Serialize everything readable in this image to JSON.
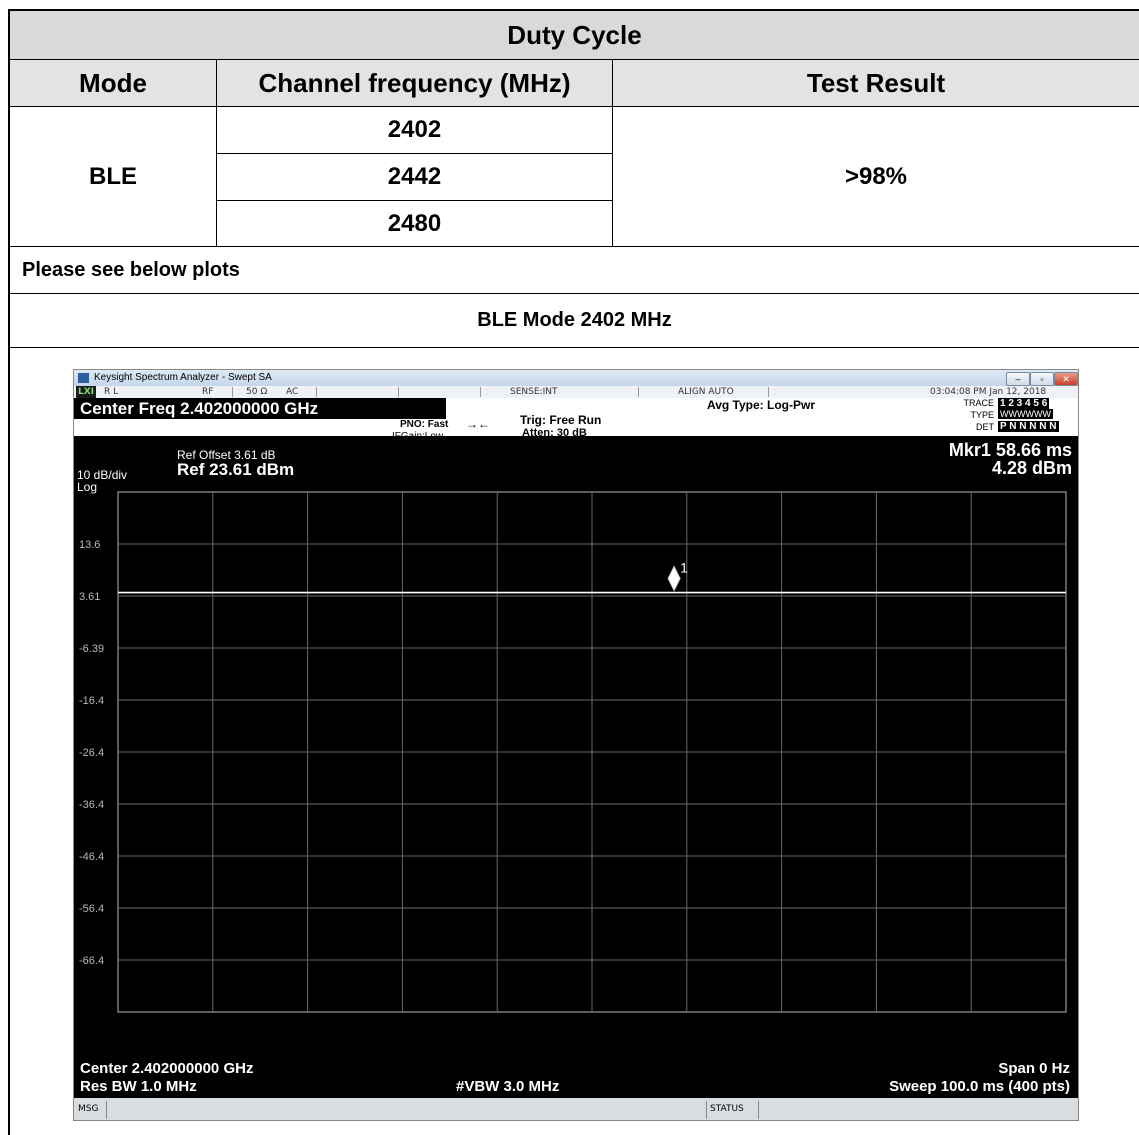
{
  "table": {
    "title": "Duty Cycle",
    "headers": [
      "Mode",
      "Channel frequency (MHz)",
      "Test Result"
    ],
    "mode": "BLE",
    "channels": [
      "2402",
      "2442",
      "2480"
    ],
    "result": ">98%",
    "note": "Please see below plots",
    "plot_caption": "BLE Mode 2402 MHz"
  },
  "analyzer": {
    "window_title": "Keysight Spectrum Analyzer - Swept SA",
    "window_buttons": [
      "–",
      "▫",
      "✕"
    ],
    "status_row": {
      "lxi": "LXI",
      "rl": "R L",
      "rf": "RF",
      "impedance": "50 Ω",
      "coupling": "AC",
      "sense": "SENSE:INT",
      "align": "ALIGN AUTO",
      "timestamp": "03:04:08 PM Jan 12, 2018"
    },
    "center_freq_title": "Center Freq 2.402000000 GHz",
    "pno": "PNO: Fast",
    "ifgain": "IFGain:Low",
    "trig": "Trig: Free Run",
    "atten": "Atten: 30 dB",
    "avg_type": "Avg Type: Log-Pwr",
    "trace_panel": {
      "trace_label": "TRACE",
      "trace_values": "1 2 3 4 5 6",
      "type_label": "TYPE",
      "type_values": "WWWWWW",
      "det_label": "DET",
      "det_values": "P N N N N N"
    },
    "ref_offset": "Ref Offset 3.61 dB",
    "ref_level": "Ref 23.61 dBm",
    "scale": "10 dB/div",
    "scale_type": "Log",
    "marker_readout_1": "Mkr1 58.66 ms",
    "marker_readout_2": "4.28 dBm",
    "marker_label": "1",
    "bottom": {
      "center": "Center 2.402000000 GHz",
      "span": "Span 0 Hz",
      "res_bw": "Res BW 1.0 MHz",
      "vbw": "#VBW 3.0 MHz",
      "sweep": "Sweep  100.0 ms (400 pts)"
    },
    "msg_label": "MSG",
    "status_label": "STATUS"
  },
  "chart_data": {
    "type": "line",
    "title": "",
    "xlabel": "",
    "ylabel": "",
    "x_range_ms": [
      0,
      100
    ],
    "ylim": [
      -76.39,
      23.61
    ],
    "y_unit": "dBm",
    "y_tick_labels": [
      "13.6",
      "3.61",
      "-6.39",
      "-16.4",
      "-26.4",
      "-36.4",
      "-46.4",
      "-56.4",
      "-66.4"
    ],
    "y_ticks": [
      13.61,
      3.61,
      -6.39,
      -16.39,
      -26.39,
      -36.39,
      -46.39,
      -56.39,
      -66.39
    ],
    "x_divisions": 10,
    "y_divisions": 10,
    "grid": true,
    "series": [
      {
        "x": [
          0,
          100
        ],
        "y": [
          4.28,
          4.28
        ],
        "color": "#ffffff"
      }
    ],
    "markers": [
      {
        "label": "1",
        "x_ms": 58.66,
        "y_dbm": 4.28
      }
    ]
  }
}
